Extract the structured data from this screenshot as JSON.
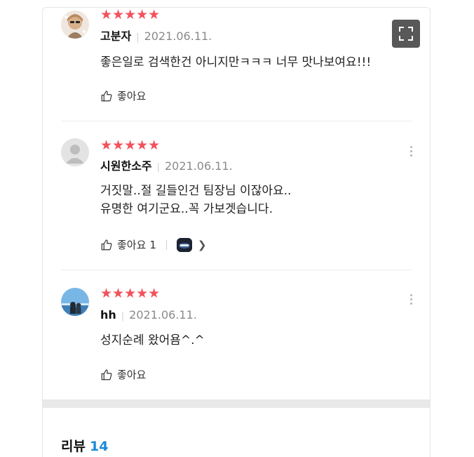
{
  "reviews": [
    {
      "stars": "★★★★★",
      "name": "고분자",
      "date": "2021.06.11.",
      "lines": [
        "좋은일로 검색한건 아니지만ㅋㅋㅋ 너무 맛나보여요!!!"
      ],
      "like_label": "좋아요",
      "like_count": ""
    },
    {
      "stars": "★★★★★",
      "name": "시원한소주",
      "date": "2021.06.11.",
      "lines": [
        "거짓말..절 길들인건 팀장님 이잖아요..",
        "유명한 여기군요..꼭 가보겟습니다."
      ],
      "like_label": "좋아요",
      "like_count": "1"
    },
    {
      "stars": "★★★★★",
      "name": "hh",
      "date": "2021.06.11.",
      "lines": [
        "성지순례 왔어욤^.^"
      ],
      "like_label": "좋아요",
      "like_count": ""
    }
  ],
  "section": {
    "title": "리뷰",
    "count": "14"
  },
  "colors": {
    "star": "#f2525c",
    "count_accent": "#1b8bd9",
    "date": "#8a8a8a"
  },
  "icons": {
    "like": "thumbs-up-icon",
    "more": "more-vertical-icon",
    "expand": "fullscreen-icon",
    "reply": "chevron-right-icon"
  }
}
